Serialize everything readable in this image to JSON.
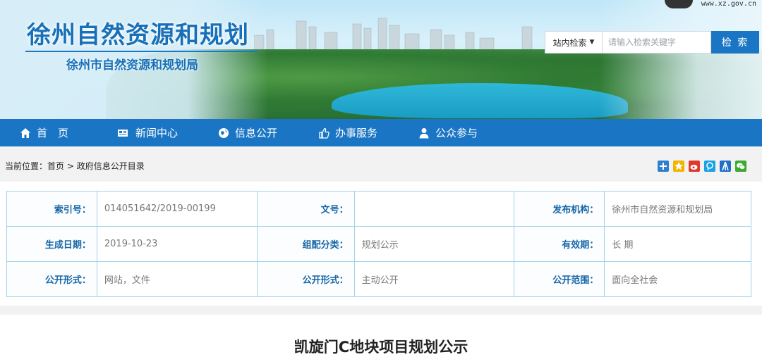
{
  "header": {
    "site_title": "徐州自然资源和规划",
    "site_subtitle": "徐州市自然资源和规划局",
    "logo_url": "www.xz.gov.cn"
  },
  "search": {
    "scope_label": "站内检索",
    "placeholder": "请输入检索关键字",
    "button_label": "检 索"
  },
  "nav": {
    "items": [
      {
        "label": "首　页",
        "icon": "home-icon"
      },
      {
        "label": "新闻中心",
        "icon": "newspaper-icon"
      },
      {
        "label": "信息公开",
        "icon": "globe-icon"
      },
      {
        "label": "办事服务",
        "icon": "thumbs-up-icon"
      },
      {
        "label": "公众参与",
        "icon": "user-icon"
      }
    ]
  },
  "breadcrumb": {
    "prefix": "当前位置：",
    "home": "首页",
    "separator": " > ",
    "current": "政府信息公开目录"
  },
  "share_icons": [
    {
      "name": "share-plus-icon",
      "color": "#2f7fd0"
    },
    {
      "name": "share-qzone-icon",
      "color": "#f3b400"
    },
    {
      "name": "share-weibo-icon",
      "color": "#e0392b"
    },
    {
      "name": "share-tencent-icon",
      "color": "#1aa1e6"
    },
    {
      "name": "share-renren-icon",
      "color": "#1f6fc7"
    },
    {
      "name": "share-wechat-icon",
      "color": "#3aab2c"
    }
  ],
  "info": {
    "rows": [
      [
        {
          "label": "索引号：",
          "value": "014051642/2019-00199"
        },
        {
          "label": "文号：",
          "value": ""
        },
        {
          "label": "发布机构：",
          "value": "徐州市自然资源和规划局"
        }
      ],
      [
        {
          "label": "生成日期：",
          "value": "2019-10-23"
        },
        {
          "label": "组配分类：",
          "value": "规划公示"
        },
        {
          "label": "有效期：",
          "value": "长 期"
        }
      ],
      [
        {
          "label": "公开形式：",
          "value": "网站，文件"
        },
        {
          "label": "公开形式：",
          "value": "主动公开"
        },
        {
          "label": "公开范围：",
          "value": "面向全社会"
        }
      ]
    ]
  },
  "article": {
    "title": "凯旋门C地块项目规划公示"
  }
}
